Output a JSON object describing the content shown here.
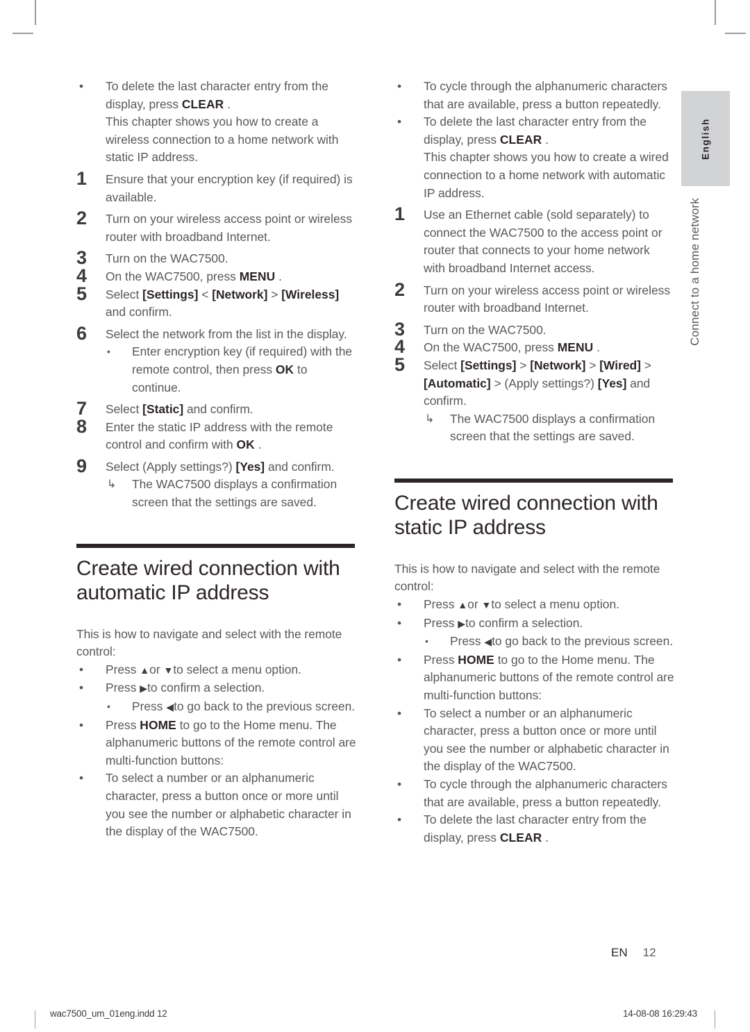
{
  "page": {
    "folio_lang": "EN",
    "folio_number": "12",
    "side_tab_label": "English",
    "side_chapter_label": "Connect to a home network"
  },
  "printer_footer": {
    "filename": "wac7500_um_01eng.indd   12",
    "timestamp": "14-08-08   16:29:43"
  },
  "glyphs": {
    "bullet": "•",
    "bullet_small": "•",
    "arrow_note": "↳",
    "up": "▲",
    "down": "▼",
    "right": "▶",
    "left": "◀"
  },
  "left_column": {
    "carryover_bullets": [
      {
        "text": "To delete the last character entry from the display, press ",
        "key": "CLEAR",
        "tail": " ."
      }
    ],
    "carryover_paragraph": "This chapter shows you how to create a wireless connection to a home network with static IP address.",
    "steps": [
      {
        "num": "1",
        "text": "Ensure that your encryption key (if required) is available."
      },
      {
        "num": "2",
        "text": "Turn on your wireless access point or wireless router with broadband Internet."
      },
      {
        "num": "3",
        "text": "Turn on the WAC7500."
      },
      {
        "num": "4",
        "pre": "On the WAC7500, press ",
        "key": "MENU",
        "post": " ."
      },
      {
        "num": "5",
        "pre": "Select ",
        "menu1": "[Settings]",
        "sep1": " < ",
        "menu2": "[Network]",
        "sep2": " > ",
        "menu3": "[Wireless]",
        "post": " and confirm."
      },
      {
        "num": "6",
        "text": "Select the network from the list in the display."
      },
      {
        "num": "7",
        "pre": "Select ",
        "menu1": "[Static]",
        "post": " and confirm."
      },
      {
        "num": "8",
        "pre": "Enter the static IP address with the remote control and confirm with ",
        "key": "OK",
        "post": " ."
      },
      {
        "num": "9",
        "pre": "Select (Apply settings?) ",
        "menu1": "[Yes]",
        "post": " and confirm."
      }
    ],
    "step6_sub_bullet": {
      "pre": "Enter encryption key (if required) with the remote control, then press ",
      "key": "OK",
      "post": " to continue."
    },
    "step9_note": "The WAC7500 displays a confirmation screen that the settings are saved.",
    "heading": "Create wired connection with automatic IP address",
    "intro": "This is how to navigate and select with the remote control:",
    "nav_bullets": [
      {
        "pre": "Press ",
        "glyph1": "▲",
        "mid": "or ",
        "glyph2": "▼",
        "post": "to select a menu option."
      },
      {
        "pre": "Press ",
        "glyph1": "▶",
        "post": "to confirm a selection."
      }
    ],
    "nav_sub_bullet": {
      "pre": "Press ",
      "glyph1": "◀",
      "post": "to go back to the previous screen."
    },
    "home_bullet": {
      "pre": "Press ",
      "key": "HOME",
      "post": " to go to the Home menu. The alphanumeric buttons of the remote control are multi-function buttons:"
    },
    "alnum_bullet": "To select a number or an alphanumeric character, press a button once or more until you see the number or alphabetic character in the display of the WAC7500."
  },
  "right_column": {
    "carryover_bullets": [
      {
        "text": "To cycle through the alphanumeric characters that are available, press a button repeatedly."
      },
      {
        "text": "To delete the last character entry from the display, press ",
        "key": "CLEAR",
        "tail": " ."
      }
    ],
    "carryover_paragraph": "This chapter shows you how to create a wired connection to a home network with automatic IP address.",
    "steps": [
      {
        "num": "1",
        "text": "Use an Ethernet cable (sold separately) to connect the WAC7500 to the access point or router that connects to your home network with broadband Internet access."
      },
      {
        "num": "2",
        "text": "Turn on your wireless access point or wireless router with broadband Internet."
      },
      {
        "num": "3",
        "text": "Turn on the WAC7500."
      },
      {
        "num": "4",
        "pre": "On the WAC7500, press ",
        "key": "MENU",
        "post": " ."
      },
      {
        "num": "5",
        "pre": "Select ",
        "menu1": "[Settings]",
        "sep1": " > ",
        "menu2": "[Network]",
        "sep2": " > ",
        "menu3": "[Wired]",
        "sep3": " > ",
        "menu4": "[Automatic]",
        "sep4": " > (Apply settings?) ",
        "menu5": "[Yes]",
        "post": " and confirm."
      }
    ],
    "step5_note": "The WAC7500 displays a confirmation screen that the settings are saved.",
    "heading": "Create wired connection with static IP address",
    "intro": "This is how to navigate and select with the remote control:",
    "nav_bullets": [
      {
        "pre": "Press ",
        "glyph1": "▲",
        "mid": "or ",
        "glyph2": "▼",
        "post": "to select a menu option."
      },
      {
        "pre": "Press ",
        "glyph1": "▶",
        "post": "to confirm a selection."
      }
    ],
    "nav_sub_bullet": {
      "pre": "Press ",
      "glyph1": "◀",
      "post": "to go back to the previous screen."
    },
    "home_bullet": {
      "pre": "Press ",
      "key": "HOME",
      "post": " to go to the Home menu. The alphanumeric buttons of the remote control are multi-function buttons:"
    },
    "alnum_bullet": "To select a number or an alphanumeric character, press a button once or more until you see the number or alphabetic character in the display of the WAC7500.",
    "cycle_bullet": "To cycle through the alphanumeric characters that are available, press a button repeatedly.",
    "delete_bullet": {
      "pre": "To delete the last character entry from the display, press ",
      "key": "CLEAR",
      "post": " ."
    }
  }
}
